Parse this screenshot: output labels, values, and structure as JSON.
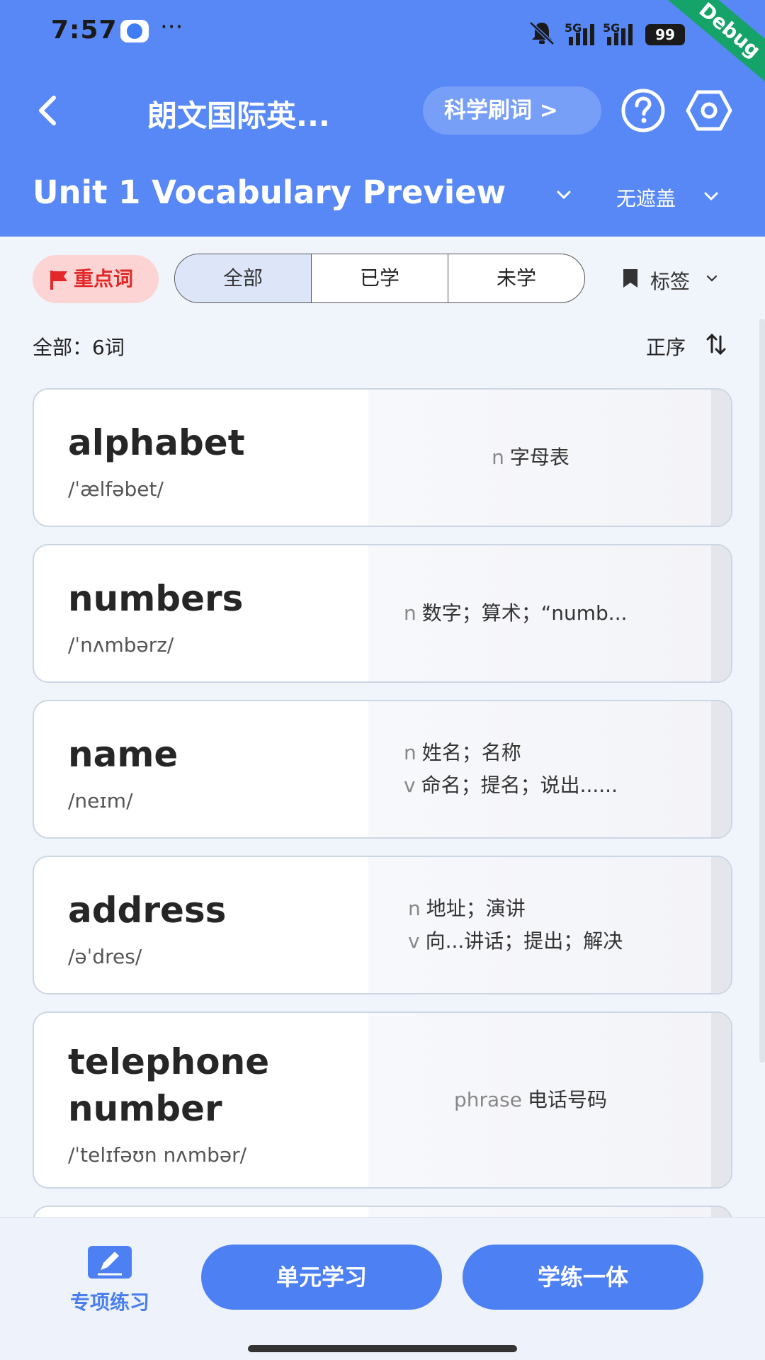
{
  "status_bar": {
    "time": "7:57",
    "more": "···",
    "signal_label_1": "5G",
    "signal_label_2": "5G",
    "battery": "99"
  },
  "debug_ribbon": "Debug",
  "nav": {
    "title": "朗文国际英...",
    "science_button": "科学刷词 >",
    "icons": [
      "back-icon",
      "help-icon",
      "settings-icon"
    ]
  },
  "unit": {
    "title": "Unit 1 Vocabulary Preview",
    "cover_mode": "无遮盖"
  },
  "filters": {
    "key_words": "重点词",
    "segments": [
      "全部",
      "已学",
      "未学"
    ],
    "active_segment": "全部",
    "tag": "标签"
  },
  "list_header": {
    "count": "全部：6词",
    "order": "正序"
  },
  "words": [
    {
      "word": "alphabet",
      "phonetic": "/ˈælfəbet/",
      "meanings": [
        {
          "pos": "n",
          "text": "字母表"
        }
      ]
    },
    {
      "word": "numbers",
      "phonetic": "/ˈnʌmbərz/",
      "meanings": [
        {
          "pos": "n",
          "text": "数字；算术；“numb..."
        }
      ]
    },
    {
      "word": "name",
      "phonetic": "/neɪm/",
      "meanings": [
        {
          "pos": "n",
          "text": "姓名；名称"
        },
        {
          "pos": "v",
          "text": "命名；提名；说出......"
        }
      ]
    },
    {
      "word": "address",
      "phonetic": "/əˈdres/",
      "meanings": [
        {
          "pos": "n",
          "text": "地址；演讲"
        },
        {
          "pos": "v",
          "text": "向...讲话；提出；解决"
        }
      ]
    },
    {
      "word": "telephone number",
      "word_line1": "telephone",
      "word_line2": "number",
      "phonetic": "/ˈtelɪfəʊn nʌmbər/",
      "meanings": [
        {
          "pos": "phrase",
          "text": "电话号码"
        }
      ]
    }
  ],
  "bottom": {
    "special": "专项练习",
    "unit_study": "单元学习",
    "study_practice": "学练一体"
  },
  "colors": {
    "primary": "#5788f5",
    "button": "#4d80f3",
    "key_bg": "#fcd4d4",
    "key_text": "#e22828"
  }
}
